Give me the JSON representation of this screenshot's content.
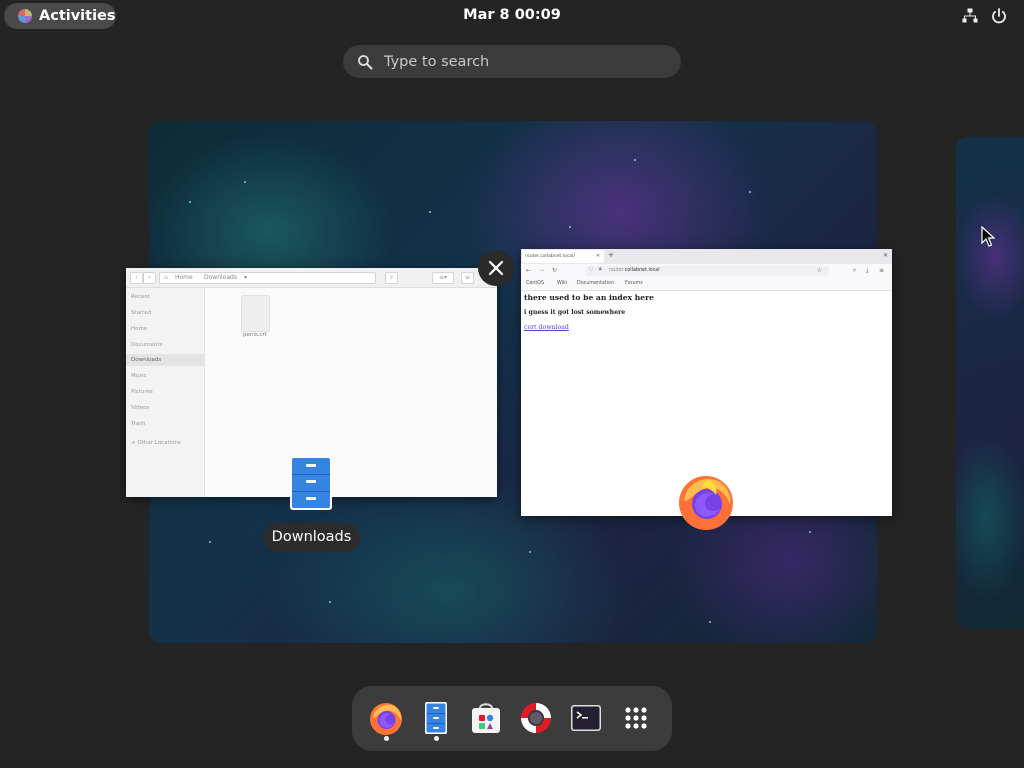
{
  "topbar": {
    "activities_label": "Activities",
    "clock": "Mar 8  00:09"
  },
  "search": {
    "placeholder": "Type to search"
  },
  "files_window": {
    "path_home": "Home",
    "path_folder": "Downloads",
    "sidebar": [
      "Recent",
      "Starred",
      "Home",
      "Documents",
      "Downloads",
      "Music",
      "Pictures",
      "Videos",
      "Trash",
      "+ Other Locations"
    ],
    "active_item": "Downloads",
    "file_name": "penis.crt"
  },
  "firefox_window": {
    "tab_title": "router.collabnet.local/",
    "url_domain": "router.",
    "url_host": "collabnet.local",
    "bookmarks": [
      "CentOS",
      "Wiki",
      "Documentation",
      "Forums"
    ],
    "heading": "there used to be an index here",
    "subheading": "i guess it got lost somewhere",
    "link_text": "cert download"
  },
  "window_labels": {
    "files": "Downloads"
  },
  "dock": {
    "items": [
      "firefox-icon",
      "files-icon",
      "software-icon",
      "help-icon",
      "terminal-icon",
      "app-grid-icon"
    ],
    "running": [
      "firefox-icon",
      "files-icon"
    ]
  },
  "colors": {
    "background": "#242424",
    "dock": "#3c3c3c",
    "link": "#5a3ed8",
    "files_blue": "#3584e4"
  }
}
